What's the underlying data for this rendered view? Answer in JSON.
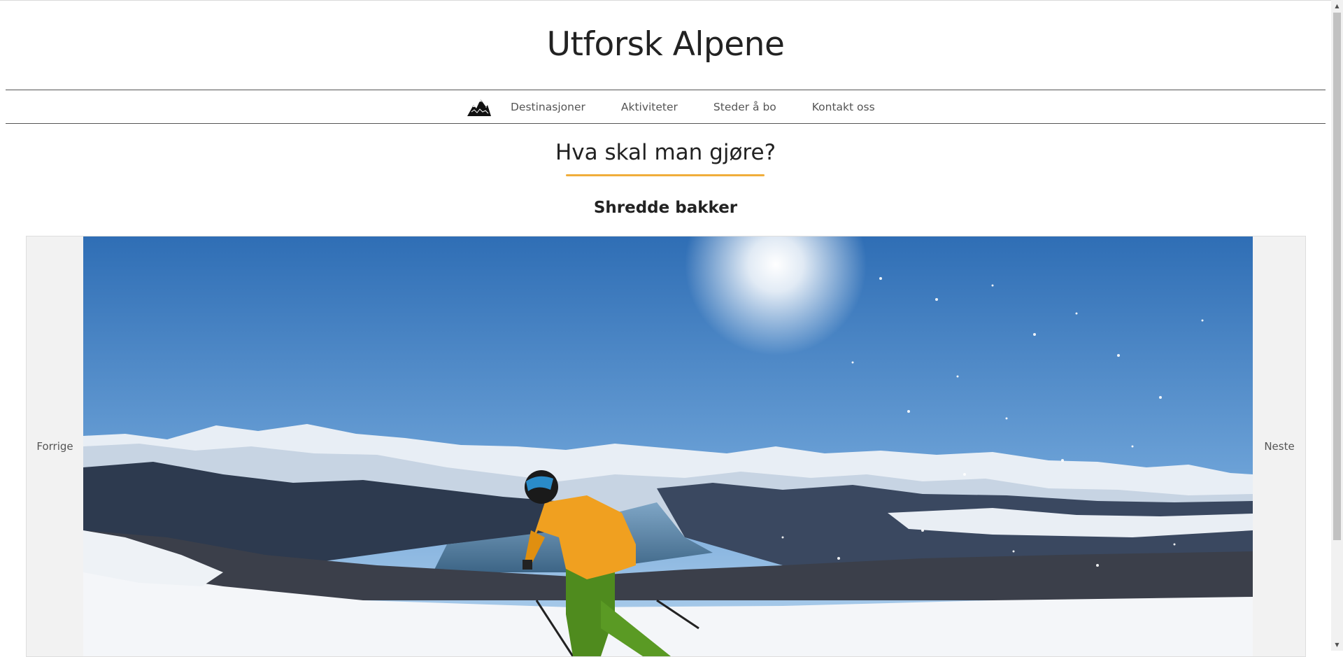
{
  "site": {
    "title": "Utforsk Alpene"
  },
  "nav": {
    "logo_icon": "mountain-logo-icon",
    "items": [
      {
        "label": "Destinasjoner"
      },
      {
        "label": "Aktiviteter"
      },
      {
        "label": "Steder å bo"
      },
      {
        "label": "Kontakt oss"
      }
    ]
  },
  "section": {
    "title": "Hva skal man gjøre?",
    "underline_color": "#f0ad3b"
  },
  "carousel": {
    "caption": "Shredde bakker",
    "prev_label": "Forrige",
    "next_label": "Neste",
    "image_subject": "skier-on-snowy-mountain-slope"
  },
  "scrollbar": {
    "up_icon": "scroll-up-arrow-icon",
    "down_icon": "scroll-down-arrow-icon"
  }
}
